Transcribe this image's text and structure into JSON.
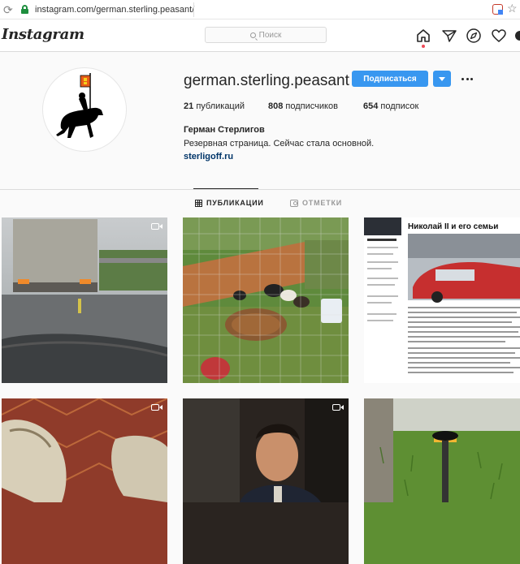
{
  "browser": {
    "url": "instagram.com/german.sterling.peasant/"
  },
  "header": {
    "logo": "Instagram",
    "search_placeholder": "Поиск"
  },
  "profile": {
    "username": "german.sterling.peasant",
    "follow_label": "Подписаться",
    "stats": {
      "posts_count": "21",
      "posts_label": "публикаций",
      "followers_count": "808",
      "followers_label": "подписчиков",
      "following_count": "654",
      "following_label": "подписок"
    },
    "full_name": "Герман Стерлигов",
    "bio": "Резервная страница. Сейчас стала основной.",
    "link": "sterligoff.ru"
  },
  "tabs": [
    {
      "label": "ПУБЛИКАЦИИ",
      "active": true
    },
    {
      "label": "ОТМЕТКИ",
      "active": false
    }
  ],
  "posts": [
    {
      "kind": "video",
      "subject": "truck on rainy road"
    },
    {
      "kind": "photo",
      "subject": "chicks in cage"
    },
    {
      "kind": "photo",
      "subject": "news article",
      "headline": "Николай II и его семьи"
    },
    {
      "kind": "video",
      "subject": "boots on carpet"
    },
    {
      "kind": "video",
      "subject": "man in movie scene"
    },
    {
      "kind": "photo",
      "subject": "device on grass"
    }
  ],
  "colors": {
    "accent": "#3897f0",
    "link": "#003569",
    "notification": "#ed4956"
  }
}
